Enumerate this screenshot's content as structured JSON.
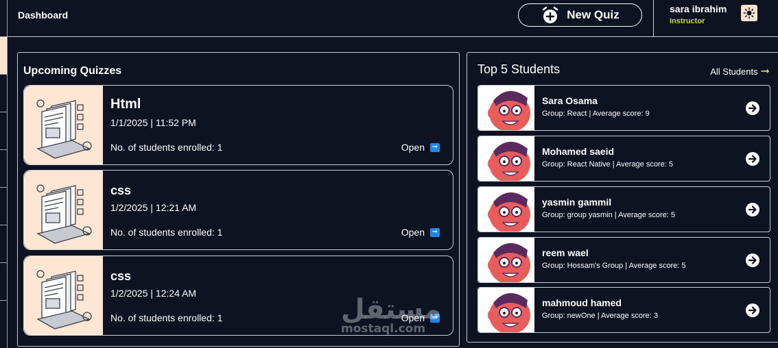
{
  "header": {
    "breadcrumb": "Dashboard",
    "new_quiz_label": "New Quiz",
    "user": {
      "name": "sara ibrahim",
      "role": "Instructor"
    }
  },
  "quizzes": {
    "title": "Upcoming Quizzes",
    "items": [
      {
        "title": "Html",
        "date": "1/1/2025 | 11:52 PM",
        "enrolled": "No. of students enrolled: 1",
        "open_label": "Open"
      },
      {
        "title": "css",
        "date": "1/2/2025 | 12:21 AM",
        "enrolled": "No. of students enrolled: 1",
        "open_label": "Open"
      },
      {
        "title": "css",
        "date": "1/2/2025 | 12:24 AM",
        "enrolled": "No. of students enrolled: 1",
        "open_label": "Open"
      }
    ]
  },
  "students": {
    "title": "Top 5 Students",
    "all_label": "All Students",
    "items": [
      {
        "name": "Sara Osama",
        "meta": "Group: React | Average score: 9"
      },
      {
        "name": "Mohamed saeid",
        "meta": "Group: React Native | Average score: 5"
      },
      {
        "name": "yasmin gammil",
        "meta": "Group: group yasmin | Average score: 5"
      },
      {
        "name": "reem wael",
        "meta": "Group: Hossam's Group | Average score: 5"
      },
      {
        "name": "mahmoud hamed",
        "meta": "Group: newOne | Average score: 3"
      }
    ]
  },
  "watermark": {
    "arabic": "مستقل",
    "latin": "mostaql.com"
  },
  "colors": {
    "background": "#0d1321",
    "accent": "#c8d36a",
    "thumb_bg": "#fde6d3",
    "open_icon": "#1e88e5"
  },
  "icons": {
    "new_quiz": "alarm-plus-icon",
    "theme": "sun-icon",
    "open": "arrow-right-box-icon",
    "student_go": "circle-arrow-right-icon",
    "all_students": "arrow-right-icon"
  }
}
